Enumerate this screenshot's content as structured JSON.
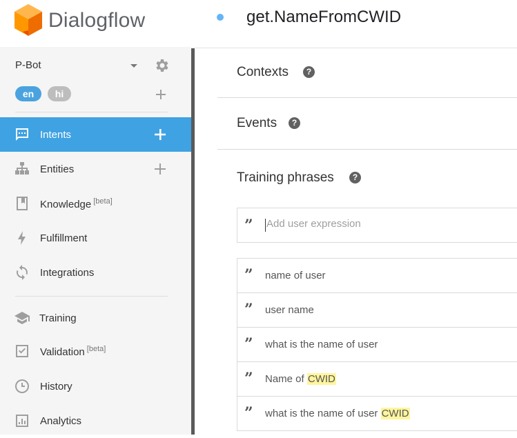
{
  "app": {
    "name": "Dialogflow"
  },
  "agent": {
    "name": "P-Bot",
    "languages": [
      "en",
      "hi"
    ]
  },
  "sidebar": {
    "items": [
      {
        "label": "Intents",
        "active": true,
        "has_add": true
      },
      {
        "label": "Entities",
        "active": false,
        "has_add": true
      },
      {
        "label": "Knowledge",
        "badge": "[beta]"
      },
      {
        "label": "Fulfillment"
      },
      {
        "label": "Integrations"
      },
      {
        "label": "Training"
      },
      {
        "label": "Validation",
        "badge": "[beta]"
      },
      {
        "label": "History"
      },
      {
        "label": "Analytics"
      }
    ]
  },
  "intent": {
    "title": "get.NameFromCWID"
  },
  "sections": {
    "contexts": "Contexts",
    "events": "Events",
    "training": "Training phrases",
    "help_glyph": "?"
  },
  "training_input": {
    "placeholder": "Add user expression",
    "value": ""
  },
  "phrases": [
    {
      "text": "name of user",
      "entity": ""
    },
    {
      "text": "user name",
      "entity": ""
    },
    {
      "text": "what is the name of user",
      "entity": ""
    },
    {
      "text": "Name of ",
      "entity": "CWID"
    },
    {
      "text": "what is the name of user ",
      "entity": "CWID"
    }
  ],
  "colors": {
    "accent": "#3fa2e2",
    "entity_highlight": "#fff59d",
    "logo": "#ff9800"
  }
}
